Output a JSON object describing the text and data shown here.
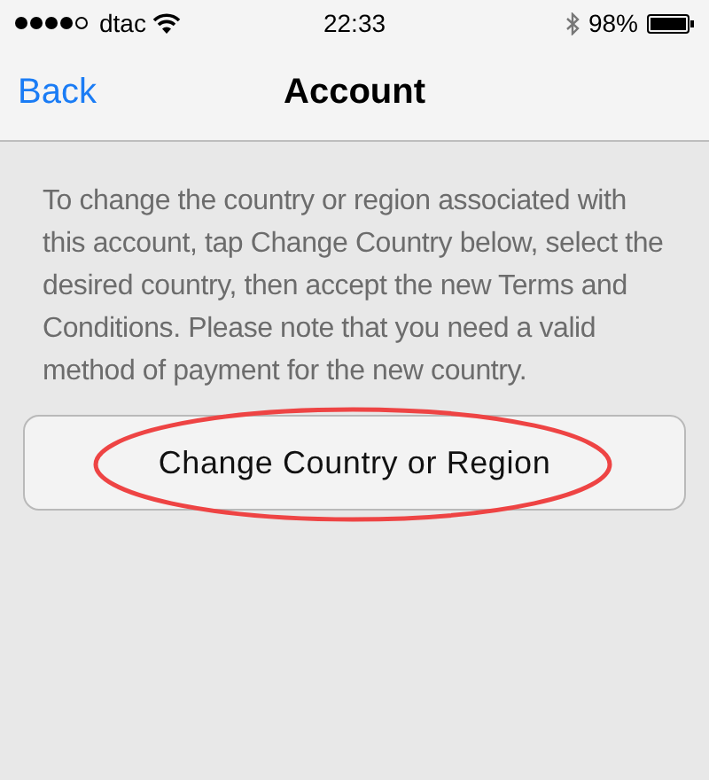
{
  "status_bar": {
    "carrier": "dtac",
    "time": "22:33",
    "battery_text": "98%"
  },
  "nav_bar": {
    "back": "Back",
    "title": "Account"
  },
  "info_text": "To change the country or region associated with this account, tap Change Country below, select the desired country, then accept the new Terms and Conditions. Please note that you need a valid method of payment for the new country.",
  "button": {
    "label": "Change Country or Region",
    "highlighted": true
  }
}
